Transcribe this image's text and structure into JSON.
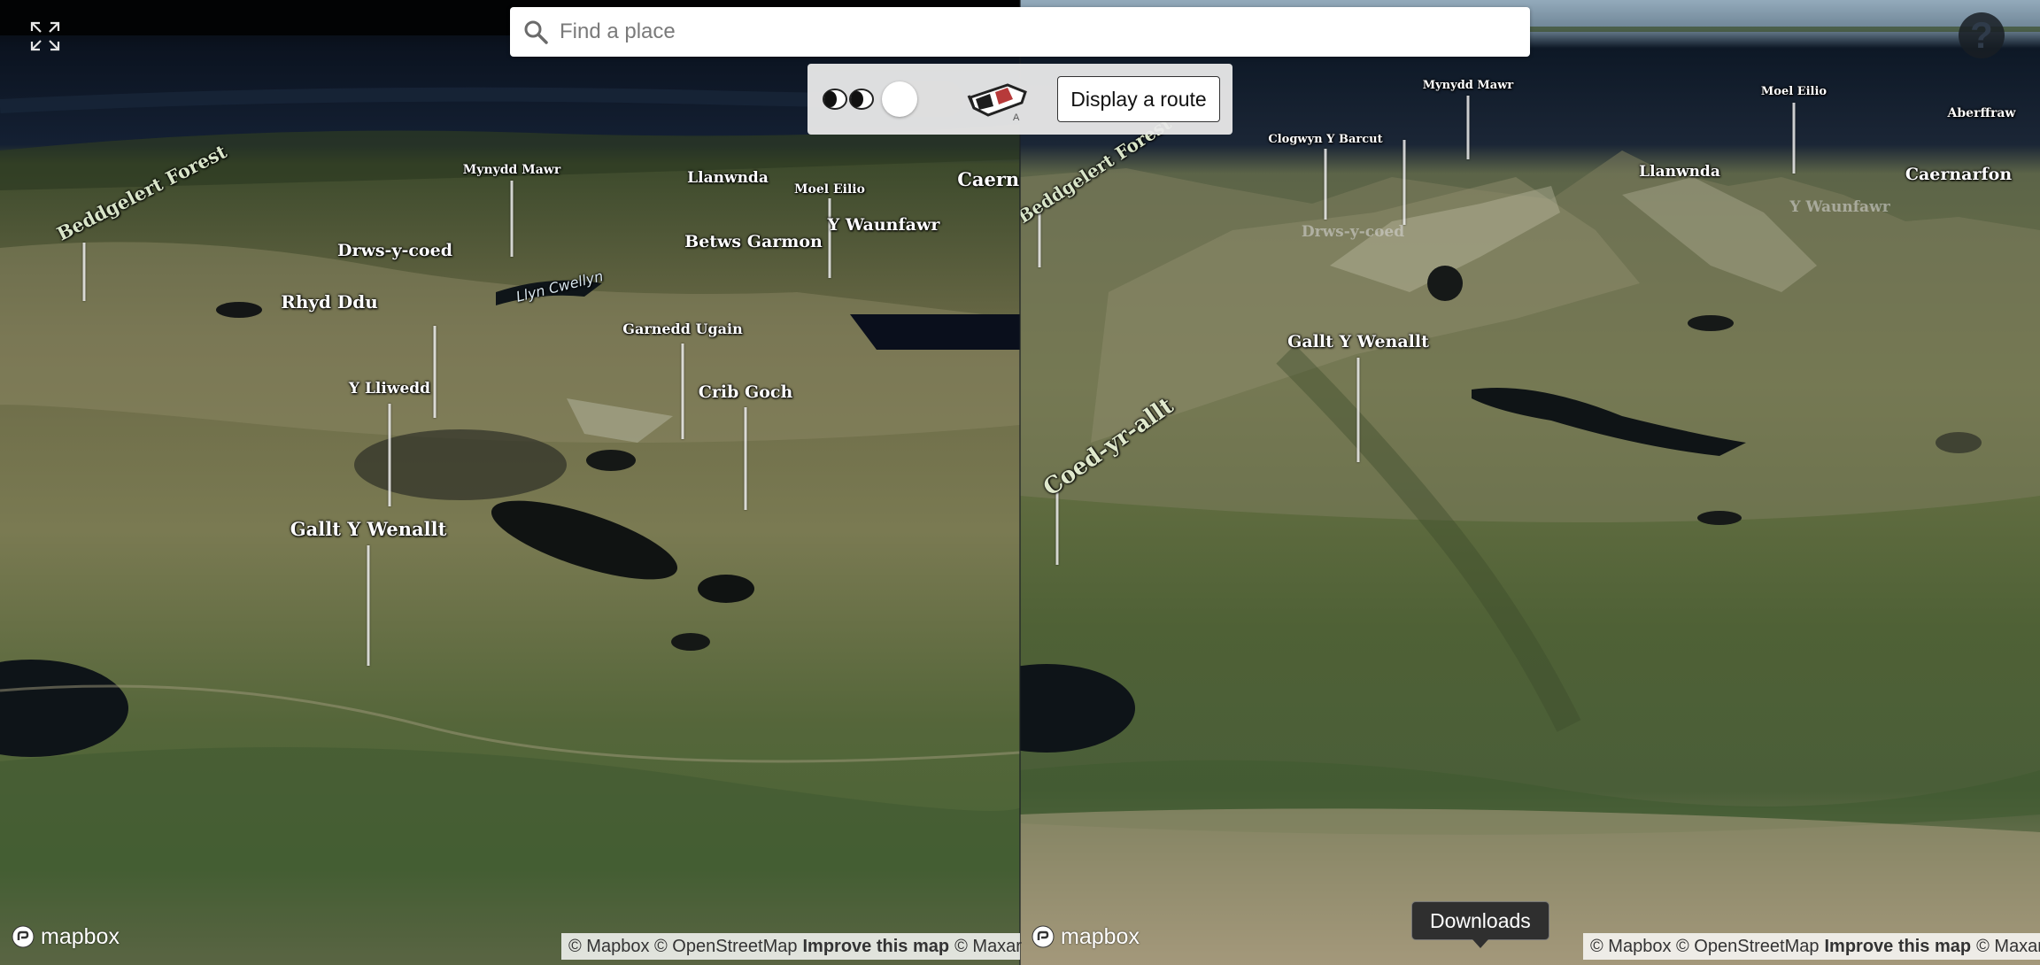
{
  "search": {
    "placeholder": "Find a place"
  },
  "controls": {
    "route_button": "Display a route"
  },
  "tooltip": {
    "downloads": "Downloads"
  },
  "help": {
    "symbol": "?"
  },
  "branding": {
    "logo_text": "mapbox"
  },
  "attribution": {
    "mapbox": "© Mapbox",
    "osm": "© OpenStreetMap",
    "improve": "Improve this map",
    "maxar": "© Maxar"
  },
  "left_labels": {
    "beddgelert_forest": "Beddgelert Forest",
    "mynydd_mawr": "Mynydd Mawr",
    "llanwnda": "Llanwnda",
    "caerna": "Caerna",
    "moel_eilio": "Moel Eilio",
    "drws_y_coed": "Drws-y-coed",
    "betws_garmon": "Betws Garmon",
    "y_waunfawr": "Y Waunfawr",
    "llyn_cwellyn": "Llyn Cwellyn",
    "rhyd_ddu": "Rhyd Ddu",
    "garnedd_ugain": "Garnedd Ugain",
    "y_lliwedd": "Y Lliwedd",
    "crib_goch": "Crib Goch",
    "gallt_y_wenallt": "Gallt Y Wenallt"
  },
  "right_labels": {
    "mynydd_mawr": "Mynydd Mawr",
    "moel_eilio": "Moel Eilio",
    "aberffraw": "Aberffraw",
    "clogwyn_y_barcut": "Clogwyn Y Barcut",
    "beddgelert_forest": "Beddgelert Forest",
    "llanwnda": "Llanwnda",
    "caernarfon": "Caernarfon",
    "y_waunfawr": "Y Waunfawr",
    "drws_y_coed": "Drws-y-coed",
    "gallt_y_wenallt": "Gallt Y Wenallt",
    "coed_yr_allt": "Coed-yr-allt"
  },
  "colors": {
    "sea": "#0d1826",
    "sky": "#8ea6b8",
    "grass": "#5b6a3c",
    "moor": "#8a8a5e",
    "lake": "#111316"
  }
}
